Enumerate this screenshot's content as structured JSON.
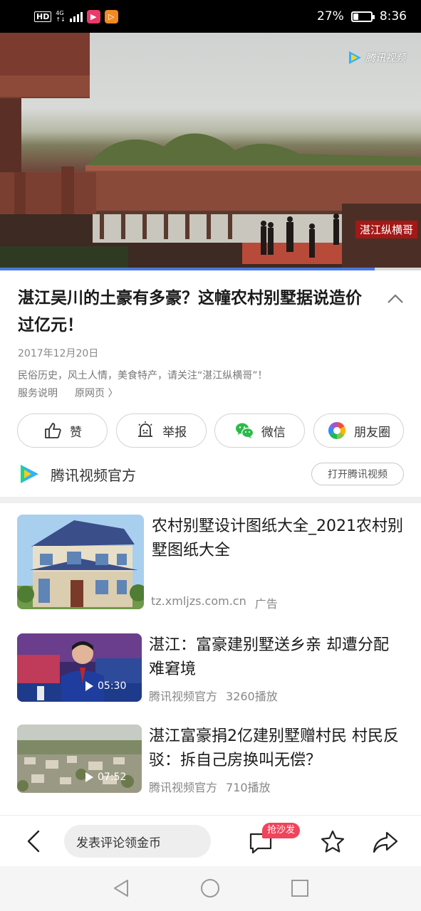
{
  "status_bar": {
    "hd": "HD",
    "network": "4G",
    "battery_percent": "27%",
    "battery_level": 0.27,
    "time": "8:36",
    "app_icons": [
      "video-app-icon",
      "play-app-icon"
    ]
  },
  "video": {
    "watermark_logo_text": "腾讯视频",
    "channel_watermark": "湛江纵横哥",
    "progress": 0.89,
    "progress_color": "#4a79e0"
  },
  "article": {
    "title": "湛江吴川的土豪有多豪？这幢农村别墅据说造价过亿元！",
    "date": "2017年12月20日",
    "description": "民俗历史，风土人情，美食特产，请关注“湛江纵横哥”！",
    "service_link": "服务说明",
    "source_link": "原网页 〉"
  },
  "actions": [
    {
      "label": "赞",
      "icon": "thumbs-up-icon"
    },
    {
      "label": "举报",
      "icon": "report-icon"
    },
    {
      "label": "微信",
      "icon": "wechat-icon"
    },
    {
      "label": "朋友圈",
      "icon": "moments-icon"
    }
  ],
  "source": {
    "name": "腾讯视频官方",
    "open_button": "打开腾讯视频"
  },
  "recommendations": [
    {
      "title": "农村别墅设计图纸大全_2021农村别墅图纸大全",
      "domain": "tz.xmljzs.com.cn",
      "tag": "广告"
    },
    {
      "title": "湛江：富豪建别墅送乡亲 却遭分配难窘境",
      "duration": "05:30",
      "author": "腾讯视频官方",
      "plays": "3260播放"
    },
    {
      "title": "湛江富豪捐2亿建别墅赠村民 村民反驳：拆自己房换叫无偿？",
      "duration": "07:52",
      "author": "腾讯视频官方",
      "plays": "710播放"
    }
  ],
  "bottom_bar": {
    "comment_placeholder": "发表评论领金币",
    "sofa_badge": "抢沙发"
  },
  "colors": {
    "accent": "#4a79e0",
    "badge": "#f0445a",
    "wechat": "#2bbb4a"
  }
}
